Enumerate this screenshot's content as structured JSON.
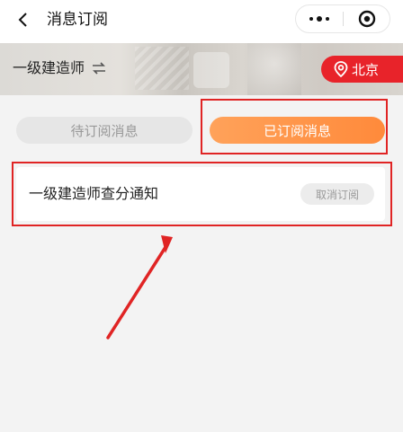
{
  "nav": {
    "title": "消息订阅",
    "back_icon": "chevron-left-icon",
    "more_icon": "more-dots-icon",
    "close_icon": "target-circle-icon"
  },
  "banner": {
    "exam_name": "一级建造师",
    "switch_icon": "swap-arrows-icon",
    "city": "北京",
    "city_icon": "location-pin-icon",
    "accent_color": "#e8232a"
  },
  "tabs": [
    {
      "label": "待订阅消息",
      "active": false
    },
    {
      "label": "已订阅消息",
      "active": true
    }
  ],
  "subscriptions": [
    {
      "title": "一级建造师查分通知",
      "action_label": "取消订阅"
    }
  ],
  "colors": {
    "active_tab": "#ff8a3b",
    "annotation": "#e02424"
  }
}
